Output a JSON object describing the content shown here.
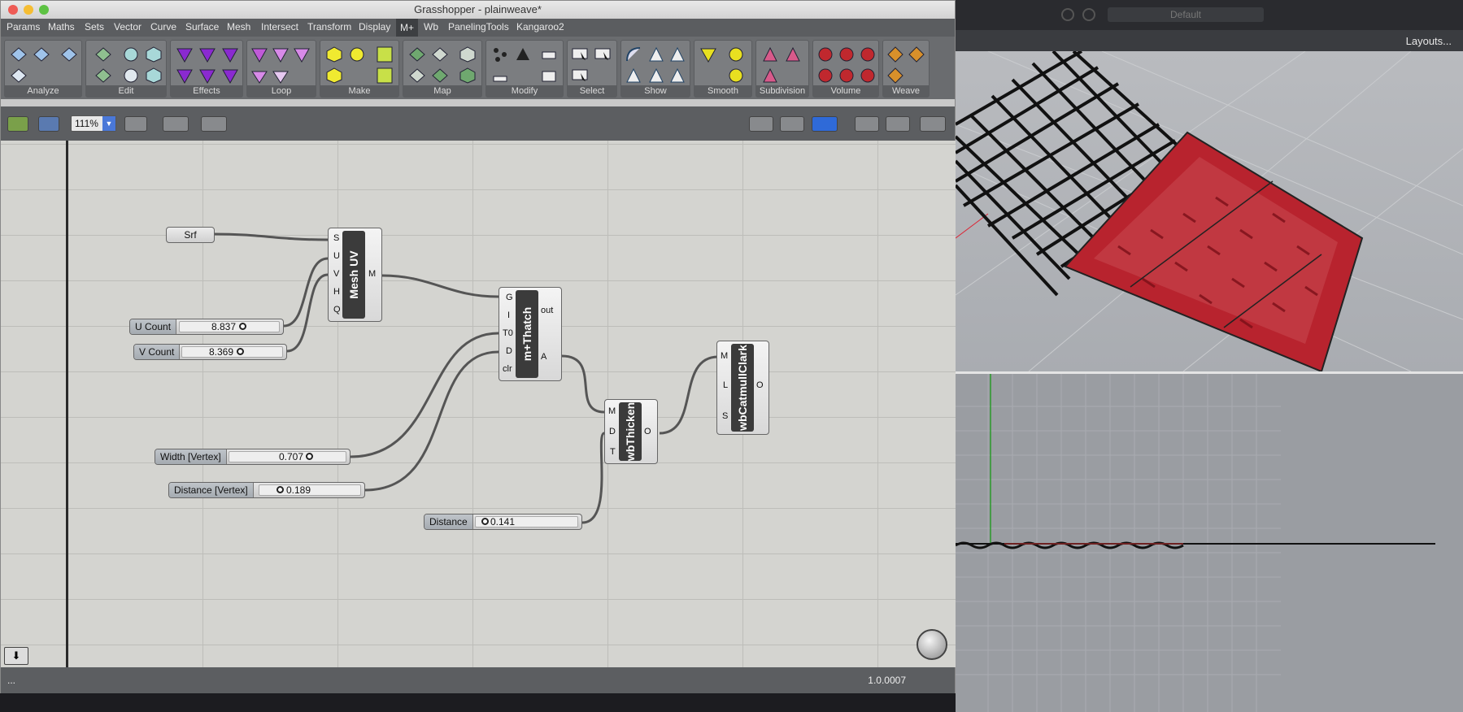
{
  "window": {
    "title": "Grasshopper - plainweave*"
  },
  "menu": [
    "Params",
    "Maths",
    "Sets",
    "Vector",
    "Curve",
    "Surface",
    "Mesh",
    "Intersect",
    "Transform",
    "Display",
    "M+",
    "Wb",
    "PanelingTools",
    "Kangaroo2"
  ],
  "ribbon_panels": [
    "Analyze",
    "Edit",
    "Effects",
    "Loop",
    "Make",
    "Map",
    "Modify",
    "Select",
    "Show",
    "Smooth",
    "Subdivision",
    "Volume",
    "Weave"
  ],
  "toolbar": {
    "zoom": "111%"
  },
  "status": {
    "left": "...",
    "version": "1.0.0007"
  },
  "rhino": {
    "layouts_label": "Layouts...",
    "default_label": "Default"
  },
  "components": {
    "srf": {
      "label": "Srf"
    },
    "mesh_uv": {
      "title": "Mesh UV",
      "inputs": [
        "S",
        "U",
        "V",
        "H",
        "Q"
      ],
      "outputs": [
        "M"
      ]
    },
    "thatch": {
      "title": "m+Thatch",
      "inputs": [
        "G",
        "I",
        "T0",
        "D",
        "clr"
      ],
      "outputs": [
        "out",
        "A"
      ]
    },
    "thicken": {
      "title": "wbThicken",
      "inputs": [
        "M",
        "D",
        "T"
      ],
      "outputs": [
        "O"
      ]
    },
    "catmull": {
      "title": "wbCatmullClark",
      "inputs": [
        "M",
        "L",
        "S"
      ],
      "outputs": [
        "O"
      ]
    }
  },
  "sliders": {
    "u_count": {
      "label": "U Count",
      "value": "8.837",
      "fraction": 0.62
    },
    "v_count": {
      "label": "V Count",
      "value": "8.369",
      "fraction": 0.58
    },
    "width": {
      "label": "Width [Vertex]",
      "value": "0.707",
      "fraction": 0.68
    },
    "distance_vertex": {
      "label": "Distance [Vertex]",
      "value": "0.189",
      "fraction": 0.0
    },
    "distance": {
      "label": "Distance",
      "value": "0.141",
      "fraction": 0.0
    }
  },
  "colors": {
    "canvas": "#d4d4d0",
    "wire": "#555555",
    "mesh_red": "#b8232e",
    "active_tab": "#3d3f42"
  }
}
